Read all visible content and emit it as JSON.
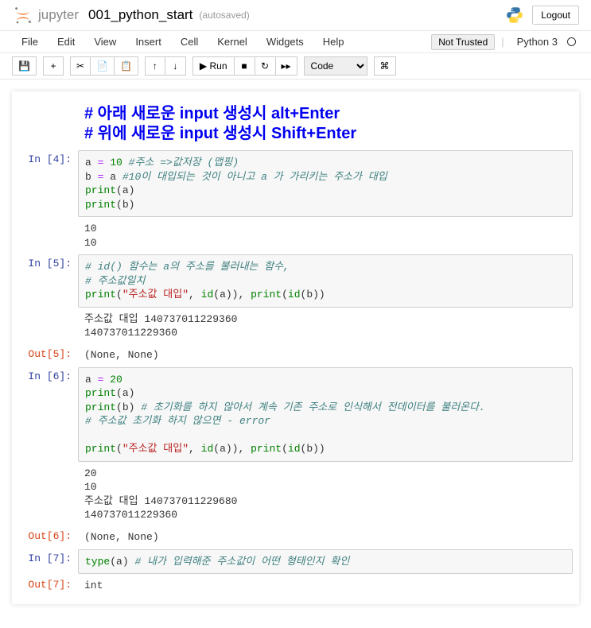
{
  "header": {
    "brand": "jupyter",
    "title": "001_python_start",
    "autosave": "(autosaved)",
    "logout": "Logout"
  },
  "menu": {
    "file": "File",
    "edit": "Edit",
    "view": "View",
    "insert": "Insert",
    "cell": "Cell",
    "kernel": "Kernel",
    "widgets": "Widgets",
    "help": "Help",
    "not_trusted": "Not Trusted",
    "kernel_name": "Python 3"
  },
  "toolbar": {
    "save_icon": "💾",
    "add_icon": "+",
    "cut_icon": "✂",
    "copy_icon": "📄",
    "paste_icon": "📋",
    "up_icon": "↑",
    "down_icon": "↓",
    "run_label": "▶ Run",
    "stop_icon": "■",
    "restart_icon": "↻",
    "ff_icon": "▸▸",
    "celltype": "Code",
    "cmd_icon": "⌘"
  },
  "cells": {
    "md_line1": "# 아래 새로운 input 생성시 alt+Enter",
    "md_line2": "# 위에 새로운 input 생성시 Shift+Enter",
    "c4": {
      "prompt": "In [4]:",
      "code": {
        "a": "a",
        "eq1": "=",
        "ten": "10",
        "cmt1": "#주소 =>값저장 (맵핑)",
        "b": "b",
        "eq2": "=",
        "aref": "a",
        "cmt2": "#10이 대입되는 것이 아니고 a 가 가리키는 주소가 대입",
        "p1": "print",
        "pa": "(a)",
        "p2": "print",
        "pb": "(b)"
      },
      "out": "10\n10"
    },
    "c5": {
      "prompt": "In [5]:",
      "code": {
        "cmt1": "# id() 함수는 a의 주소를 불러내는 함수,",
        "cmt2": "# 주소값일치",
        "p1": "print",
        "lp1": "(",
        "str": "\"주소값 대입\"",
        "c1": ", ",
        "id1": "id",
        "ida": "(a)), ",
        "p2": "print",
        "lp2": "(",
        "id2": "id",
        "idb": "(b))"
      },
      "out": "주소값 대입 140737011229360\n140737011229360",
      "outprompt": "Out[5]:",
      "result": "(None, None)"
    },
    "c6": {
      "prompt": "In [6]:",
      "code": {
        "a": "a",
        "eq": "=",
        "n20": "20",
        "p1": "print",
        "pa": "(a)",
        "p2": "print",
        "pb": "(b) ",
        "cmt1": "# 초기화를 하지 않아서 계속 기존 주소로 인식해서 전데이터를 불러온다.",
        "cmt2": "# 주소값 초기화 하지 않으면 - error",
        "p3": "print",
        "lp": "(",
        "str": "\"주소값 대입\"",
        "c1": ", ",
        "id1": "id",
        "ida": "(a)), ",
        "p4": "print",
        "lp2": "(",
        "id2": "id",
        "idb": "(b))"
      },
      "out": "20\n10\n주소값 대입 140737011229680\n140737011229360",
      "outprompt": "Out[6]:",
      "result": "(None, None)"
    },
    "c7": {
      "prompt": "In [7]:",
      "code": {
        "type": "type",
        "arg": "(a) ",
        "cmt": "# 내가 입력해준 주소값이 어떤 형태인지 확인"
      },
      "outprompt": "Out[7]:",
      "result": "int"
    }
  }
}
